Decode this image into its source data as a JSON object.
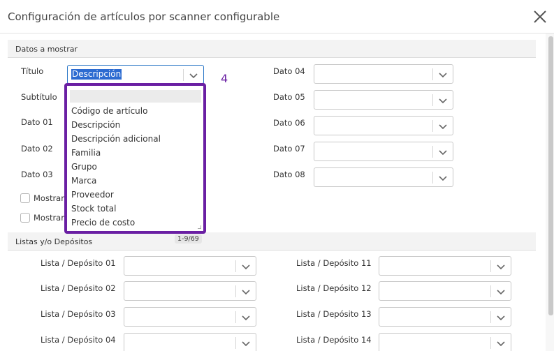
{
  "dialog": {
    "title": "Configuración de artículos por scanner configurable"
  },
  "section_datos": {
    "label": "Datos a mostrar"
  },
  "fields_left": [
    {
      "label": "Título",
      "value": "Descripción"
    },
    {
      "label": "Subtítulo"
    },
    {
      "label": "Dato 01"
    },
    {
      "label": "Dato 02"
    },
    {
      "label": "Dato 03"
    }
  ],
  "fields_right": [
    {
      "label": "Dato 04"
    },
    {
      "label": "Dato 05"
    },
    {
      "label": "Dato 06"
    },
    {
      "label": "Dato 07"
    },
    {
      "label": "Dato 08"
    }
  ],
  "checkboxes": [
    {
      "label": "Mostrar"
    },
    {
      "label": "Mostrar"
    }
  ],
  "dropdown": {
    "options": [
      "Código de artículo",
      "Descripción",
      "Descripción adicional",
      "Familia",
      "Grupo",
      "Marca",
      "Proveedor",
      "Stock total",
      "Precio de costo"
    ],
    "annotation": "4",
    "page_indicator": "1-9/69"
  },
  "section_listas": {
    "label": "Listas y/o Depósitos"
  },
  "listas_left": [
    "Lista / Depósito 01",
    "Lista / Depósito 02",
    "Lista / Depósito 03",
    "Lista / Depósito 04"
  ],
  "listas_right": [
    "Lista / Depósito 11",
    "Lista / Depósito 12",
    "Lista / Depósito 13",
    "Lista / Depósito 14"
  ],
  "colors": {
    "accent": "#6a1fa3",
    "focus": "#2c78c7"
  }
}
